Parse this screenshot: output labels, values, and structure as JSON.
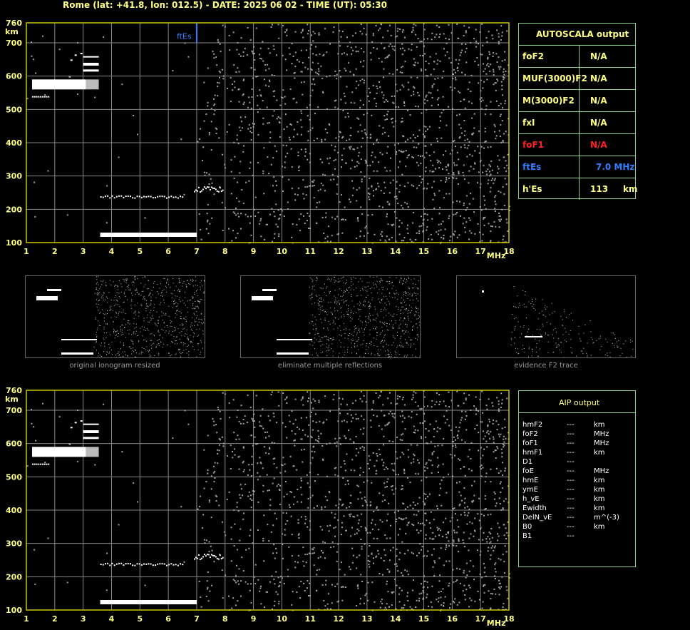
{
  "header": {
    "title": "Rome (lat: +41.8, lon: 012.5) - DATE: 2025 06 02 - TIME (UT): 05:30"
  },
  "colors": {
    "grid": "#888888",
    "axis": "#c8c800",
    "text": "#ffff80",
    "trace": "#ffffff",
    "noise": "#a0a0a0",
    "panel_border": "#8fd18f",
    "fof1_red": "#ff2020",
    "ftes_blue": "#2f7fff"
  },
  "chart_data": [
    {
      "type": "scatter",
      "name": "ionogram-autoscala",
      "xlabel": "MHz",
      "ylabel": "km",
      "xlim": [
        1,
        18
      ],
      "ylim": [
        100,
        760
      ],
      "x_ticks": [
        "1",
        "2",
        "3",
        "4",
        "5",
        "6",
        "7",
        "8",
        "9",
        "10",
        "11",
        "12",
        "13",
        "14",
        "15",
        "16",
        "17",
        "18"
      ],
      "y_ticks": [
        "100",
        "200",
        "300",
        "400",
        "500",
        "600",
        "700",
        "760"
      ],
      "grid": true,
      "traces": [
        {
          "label": "E trace",
          "x": [
            3.6,
            7.0
          ],
          "y": 125
        },
        {
          "label": "Es trace",
          "x": [
            3.6,
            6.5
          ],
          "y": 238
        },
        {
          "label": "Es 2nd",
          "x": [
            6.9,
            7.8
          ],
          "y": 262
        },
        {
          "label": "F2 multiple",
          "x": [
            1.2,
            3.5
          ],
          "y": 575
        },
        {
          "label": "F2 echo",
          "x": [
            2.5,
            3.5
          ],
          "y": 650
        }
      ],
      "annotation": {
        "text": "ftEs",
        "x": 7.0
      }
    },
    {
      "type": "scatter",
      "name": "ionogram-aip",
      "xlabel": "MHz",
      "ylabel": "km",
      "xlim": [
        1,
        18
      ],
      "ylim": [
        100,
        760
      ],
      "x_ticks": [
        "1",
        "2",
        "3",
        "4",
        "5",
        "6",
        "7",
        "8",
        "9",
        "10",
        "11",
        "12",
        "13",
        "14",
        "15",
        "16",
        "17",
        "18"
      ],
      "y_ticks": [
        "100",
        "200",
        "300",
        "400",
        "500",
        "600",
        "700",
        "760"
      ],
      "grid": true
    }
  ],
  "autoscala": {
    "title": "AUTOSCALA output",
    "rows": [
      {
        "label": "foF2",
        "value": "N/A",
        "color": "#ffff80"
      },
      {
        "label": "MUF(3000)F2",
        "value": "N/A",
        "color": "#ffff80"
      },
      {
        "label": "M(3000)F2",
        "value": "N/A",
        "color": "#ffff80"
      },
      {
        "label": "fxI",
        "value": "N/A",
        "color": "#ffff80"
      },
      {
        "label": "foF1",
        "value": "N/A",
        "color": "#ff2020"
      },
      {
        "label": "ftEs",
        "value": "7.0 MHz",
        "color": "#2f7fff"
      },
      {
        "label": "h'Es",
        "value": "113     km",
        "color": "#ffff80"
      }
    ]
  },
  "thumbnails": [
    {
      "caption": "original ionogram resized"
    },
    {
      "caption": "eliminate multiple reflections"
    },
    {
      "caption": "evidence F2 trace"
    }
  ],
  "aip": {
    "title": "AIP output",
    "rows": [
      {
        "name": "hmF2",
        "value": "---",
        "unit": "km"
      },
      {
        "name": "foF2",
        "value": "---",
        "unit": "MHz"
      },
      {
        "name": "foF1",
        "value": "---",
        "unit": "MHz"
      },
      {
        "name": "hmF1",
        "value": "---",
        "unit": "km"
      },
      {
        "name": "D1",
        "value": "---",
        "unit": ""
      },
      {
        "name": "foE",
        "value": "---",
        "unit": "MHz"
      },
      {
        "name": "hmE",
        "value": "---",
        "unit": "km"
      },
      {
        "name": "ymE",
        "value": "---",
        "unit": "km"
      },
      {
        "name": "h_vE",
        "value": "---",
        "unit": "km"
      },
      {
        "name": "Ewidth",
        "value": "---",
        "unit": "km"
      },
      {
        "name": "DelN_vE",
        "value": "---",
        "unit": "m^(-3)"
      },
      {
        "name": "B0",
        "value": "---",
        "unit": "km"
      },
      {
        "name": "B1",
        "value": "---",
        "unit": ""
      }
    ]
  }
}
